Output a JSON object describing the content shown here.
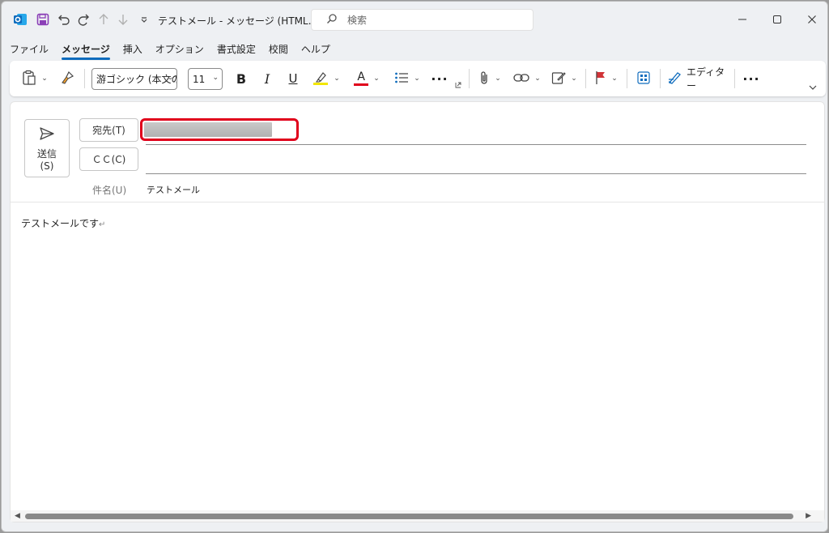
{
  "window": {
    "title": "テストメール  -  メッセージ (HTML…",
    "search_placeholder": "検索"
  },
  "menu": {
    "tabs": [
      "ファイル",
      "メッセージ",
      "挿入",
      "オプション",
      "書式設定",
      "校閲",
      "ヘルプ"
    ],
    "active": "メッセージ"
  },
  "ribbon": {
    "font_name": "游ゴシック (本文の",
    "font_size": "11",
    "bold": "B",
    "italic": "I",
    "underline": "U",
    "font_color_letter": "A",
    "editor_label": "エディター",
    "highlight_color": "#f2e600",
    "font_color": "#e0001b"
  },
  "compose": {
    "send_label_1": "送信",
    "send_label_2": "(S)",
    "to_label": "宛先(T)",
    "cc_label": "ＣＣ(C)",
    "subject_label": "件名(U)",
    "subject_value": "テストメール",
    "body": "テストメールです"
  },
  "colors": {
    "accent": "#0f6cbd",
    "highlight_box": "#e0001b",
    "outlook_icon": "#0f6cbd",
    "save_icon": "#8b3fb7",
    "flag": "#d13438"
  }
}
